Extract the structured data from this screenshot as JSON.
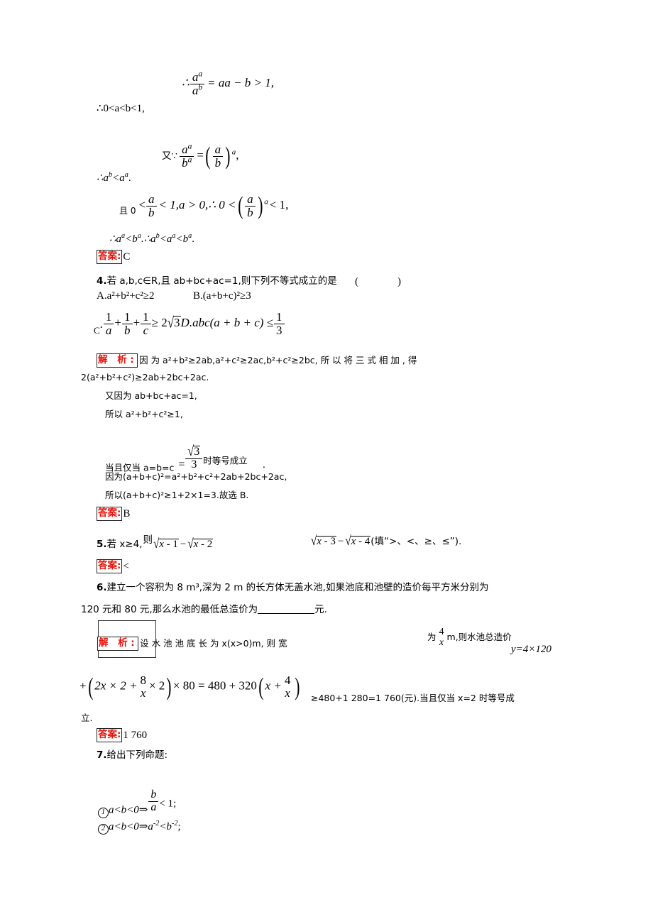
{
  "page": {
    "type": "math-workbook-solutions",
    "language": "zh-CN",
    "label_answer": "答案",
    "label_analysis": "解 析",
    "colon": ":",
    "red_accent": "#e8140c"
  },
  "q3_continued": {
    "line1_prefix": "∴",
    "line1_frac_num": "a",
    "line1_frac_num_sup": "a",
    "line1_frac_den": "a",
    "line1_frac_den_sup": "b",
    "line1_rest": "= aa − b > 1,",
    "line2": "∴0<a<b<1,",
    "line3_prefix": "又∵",
    "line3_frac_num": "a",
    "line3_frac_num_sup": "a",
    "line3_frac_den": "b",
    "line3_frac_den_sup": "a",
    "line3_eq": "=",
    "line3_paren_num": "a",
    "line3_paren_den": "b",
    "line3_paren_sup": "a",
    "line3_comma": ",",
    "line4": "∴a",
    "line4_sup1": "b",
    "line4_mid": "<a",
    "line4_sup2": "a",
    "line4_end": ".",
    "line5_prefix": "且 0",
    "line5_lt1": "<",
    "line5_frac_num": "a",
    "line5_frac_den": "b",
    "line5_mid": "< 1,a > 0,∴ 0 <",
    "line5_paren_num": "a",
    "line5_paren_den": "b",
    "line5_paren_sup": "a",
    "line5_end": "< 1,",
    "line6": "∴a",
    "line6_sup1": "a",
    "line6_m1": "<b",
    "line6_sup2": "a",
    "line6_m2": ".∴a",
    "line6_sup3": "b",
    "line6_m3": "<a",
    "line6_sup4": "a",
    "line6_m4": "<b",
    "line6_sup5": "a",
    "line6_m5": ".",
    "answer": "C"
  },
  "q4": {
    "number": "4.",
    "stem": "若 a,b,c∈R,且 ab+bc+ac=1,则下列不等式成立的是",
    "stem_italics": [
      "a,b,c",
      "ab+bc+ac"
    ],
    "paren_open": "(",
    "paren_close": ")",
    "optionA": "A.a²+b²+c²≥2",
    "optionB": "B.(a+b+c)²≥3",
    "optionC_letter": "C",
    "optionC_dot": ".",
    "optionC_body": "+ + ≥ 2√3",
    "optionC_terms": [
      "1/a",
      "1/b",
      "1/c"
    ],
    "optionC_rhs": "2√3",
    "optionD": "D.abc(a + b + c) ≤",
    "optionD_frac_num": "1",
    "optionD_frac_den": "3",
    "analysis_l1": "因 为   a²+b²≥2ab,a²+c²≥2ac,b²+c²≥2bc, 所 以 将 三 式 相 加 , 得",
    "analysis_l2": "2(a²+b²+c²)≥2ab+2bc+2ac.",
    "analysis_l3": "又因为 ab+bc+ac=1,",
    "analysis_l4": "所以 a²+b²+c²≥1,",
    "analysis_l5_pre": "当且仅当 a=b=c",
    "analysis_l5_eq": "=",
    "analysis_l5_frac_num": "√3",
    "analysis_l5_frac_den": "3",
    "analysis_l5_post": "时等号成立",
    "analysis_l5_dot": ".",
    "analysis_l6": "因为(a+b+c)²=a²+b²+c²+2ab+2bc+2ac,",
    "analysis_l7": "所以(a+b+c)²≥1+2×1=3.故选 B.",
    "answer": "B"
  },
  "q5": {
    "number": "5.",
    "stem_pre": "若 x≥4,",
    "stem_ze": "则",
    "expr_left": "√(x - 1) − √(x - 2)",
    "expr_left_parts": [
      "x - 1",
      "x - 2"
    ],
    "expr_right_parts": [
      "x - 3",
      "x - 4"
    ],
    "tail": "(填“>、<、≥、≤”).",
    "answer": "<"
  },
  "q6": {
    "number": "6.",
    "stem_l1": "建立一个容积为 8 m³,深为 2 m 的长方体无盖水池,如果池底和池壁的造价每平方米分别为",
    "stem_l2_pre": "120 元和 80 元,那么水池的最低总造价为",
    "stem_l2_blank": "",
    "stem_l2_post": "元.",
    "analysis_a": "设  水  池  池  底  长  为   x(x>0)m,  则  宽",
    "analysis_frac_pre": "为",
    "analysis_frac_num": "4",
    "analysis_frac_den": "x",
    "analysis_frac_post": "m,则水池总造价",
    "analysis_y": "y=4×120",
    "analysis_l2_a": "+",
    "analysis_l2_inner_pre": "2x × 2 +",
    "analysis_l2_inner_num": "8",
    "analysis_l2_inner_den": "x",
    "analysis_l2_inner_post": "× 2",
    "analysis_l2_b": "× 80 = 480 + 320",
    "analysis_l2_c_pre": "x +",
    "analysis_l2_c_num": "4",
    "analysis_l2_c_den": "x",
    "analysis_l2_tail": "≥480+1 280=1 760(元).当且仅当 x=2 时等号成",
    "analysis_l3": "立.",
    "answer": "1 760"
  },
  "q7": {
    "number": "7.",
    "stem": "给出下列命题:",
    "item1_circ": "1",
    "item1_pre": "a<b<0⇒",
    "item1_frac_num": "b",
    "item1_frac_den": "a",
    "item1_post": "< 1;",
    "item2_circ": "2",
    "item2_text": "a<b<0⇒a",
    "item2_sup1": "-2",
    "item2_mid": "<b",
    "item2_sup2": "-2",
    "item2_end": ";"
  }
}
